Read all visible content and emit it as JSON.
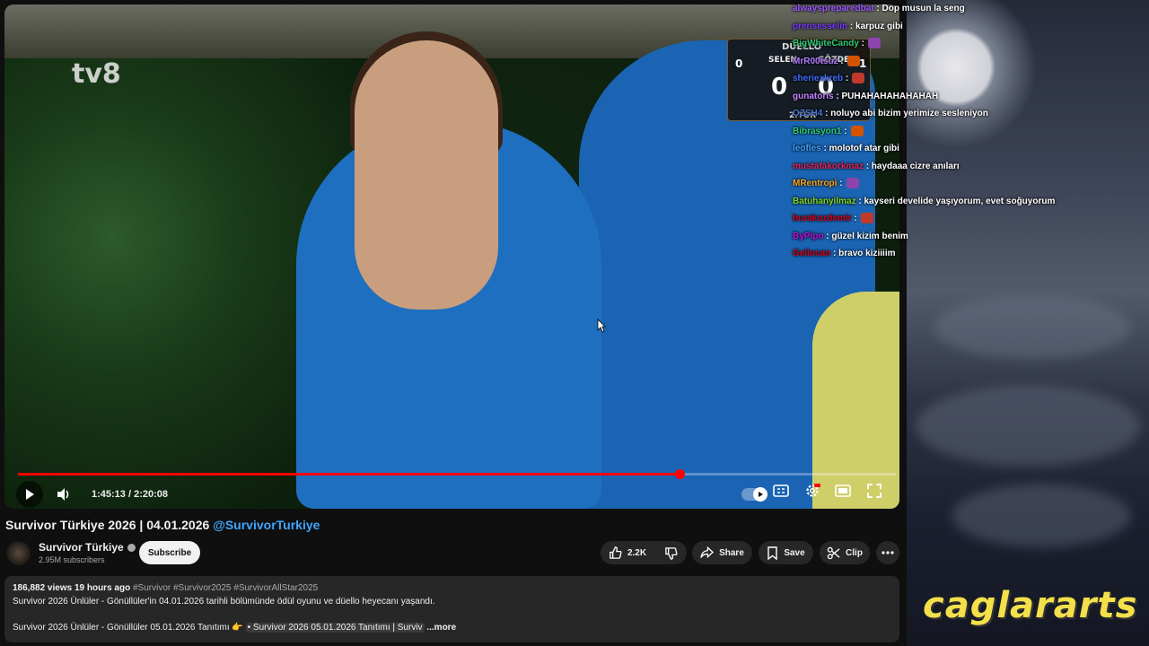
{
  "stream": {
    "brand": "caglararts"
  },
  "video": {
    "channel_watermark": "tv8",
    "scoreboard": {
      "title": "DÜELLO",
      "left_label": "SELEN",
      "right_label": "GÖZDE",
      "left_score": "0",
      "right_score": "0",
      "left_round_num": "0",
      "right_round_num": "1",
      "round_label": "2.TUR"
    },
    "progress_fraction": 0.754,
    "time": "1:45:13 / 2:20:08"
  },
  "chat": [
    {
      "user": "alwayspreparedbat",
      "user_color": "#9b59ff",
      "msg": ": Dop musun la seng"
    },
    {
      "user": "prensesselin",
      "user_color": "#7a3cff",
      "msg": ": karpuz gibi"
    },
    {
      "user": "BigWhiteCandy",
      "user_color": "#2ecc71",
      "msg": ":"
    },
    {
      "user": "MrR00tsuz",
      "user_color": "#b37cff",
      "msg": ":"
    },
    {
      "user": "sheriexkreb",
      "user_color": "#3a6cff",
      "msg": ":"
    },
    {
      "user": "gunatoris",
      "user_color": "#c084fc",
      "msg": ": PUHAHAHAHAHAHAH"
    },
    {
      "user": "OZSH4",
      "user_color": "#4a78d6",
      "msg": ": noluyo abi bizim yerimize sesleniyon"
    },
    {
      "user": "Bibrasyon1",
      "user_color": "#2ecc71",
      "msg": ":"
    },
    {
      "user": "leofles",
      "user_color": "#3ea6ff",
      "msg": ": molotof atar gibi"
    },
    {
      "user": "mustafakorkmaz",
      "user_color": "#e0245e",
      "msg": ": haydaaa cizre anıları"
    },
    {
      "user": "MRentropi",
      "user_color": "#f5a623",
      "msg": ":"
    },
    {
      "user": "Batuhanyilmaz",
      "user_color": "#7ed321",
      "msg": ": kayseri develide yaşıyorum, evet soğuyorum"
    },
    {
      "user": "burakozdemir",
      "user_color": "#d0021b",
      "msg": ":"
    },
    {
      "user": "ByPipo",
      "user_color": "#bd10e0",
      "msg": ": güzel kizim benim"
    },
    {
      "user": "Gelincan",
      "user_color": "#d0021b",
      "msg": ": bravo kiziiiim"
    }
  ],
  "watch": {
    "title": "Survivor Türkiye 2026 | 04.01.2026",
    "title_handle": "@SurvivorTurkiye",
    "channel": "Survivor Türkiye",
    "subscribers": "2.95M subscribers",
    "subscribe_label": "Subscribe",
    "likes": "2.2K",
    "share_label": "Share",
    "save_label": "Save",
    "clip_label": "Clip",
    "description": {
      "views": "186,882 views",
      "age": "19 hours ago",
      "tags": "#Survivor #Survivor2025 #SurvivorAllStar2025",
      "line1": "Survivor 2026 Ünlüler - Gönüllüler'in 04.01.2026 tarihli bölümünde ödül oyunu ve düello heyecanı yaşandı.",
      "line2_prefix": "Survivor 2026 Ünlüler - Gönüllüler 05.01.2026 Tanıtımı 👉",
      "line2_link": "• Survivor 2026 05.01.2026 Tanıtımı | Surviv",
      "more_label": "...more"
    }
  }
}
